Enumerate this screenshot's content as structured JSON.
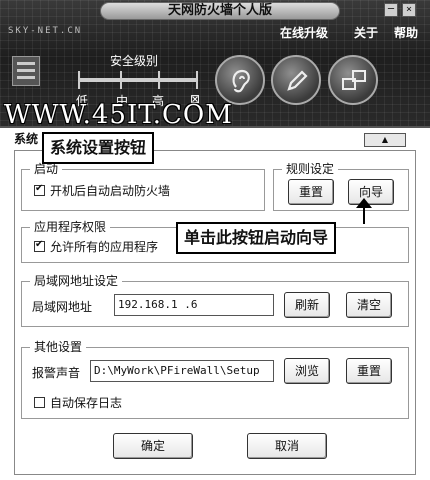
{
  "window": {
    "title": "天网防火墙个人版",
    "logo_text": "SKY-NET.CN",
    "controls": [
      "─",
      "×"
    ]
  },
  "menu": {
    "upgrade": "在线升级",
    "about": "关于",
    "help": "帮助"
  },
  "security": {
    "title": "安全级别",
    "levels": [
      "低",
      "中",
      "高",
      "⊠"
    ]
  },
  "watermark": "WWW.45IT.COM",
  "page": {
    "tab_label": "系统",
    "collapse_glyph": "▲"
  },
  "callouts": {
    "settings_button": "系统设置按钮",
    "wizard_hint": "单击此按钮启动向导"
  },
  "startup": {
    "title": "启动",
    "autostart_label": "开机后自动启动防火墙",
    "autostart_checked": true
  },
  "rules": {
    "title": "规则设定",
    "reset_label": "重置",
    "wizard_label": "向导"
  },
  "app_permissions": {
    "title": "应用程序权限",
    "allow_all_label": "允许所有的应用程序",
    "allow_all_checked": true
  },
  "lan": {
    "title": "局域网地址设定",
    "address_label": "局域网地址",
    "address_value": "192.168.1  .6",
    "refresh_label": "刷新",
    "clear_label": "清空"
  },
  "other": {
    "title": "其他设置",
    "alarm_label": "报警声音",
    "alarm_path": "D:\\MyWork\\PFireWall\\Setup",
    "browse_label": "浏览",
    "reset_label": "重置",
    "autosave_label": "自动保存日志",
    "autosave_checked": false
  },
  "footer": {
    "ok_label": "确定",
    "cancel_label": "取消"
  },
  "icons": [
    "ear-icon",
    "pen-icon",
    "network-icon",
    "equalizer-icon"
  ]
}
